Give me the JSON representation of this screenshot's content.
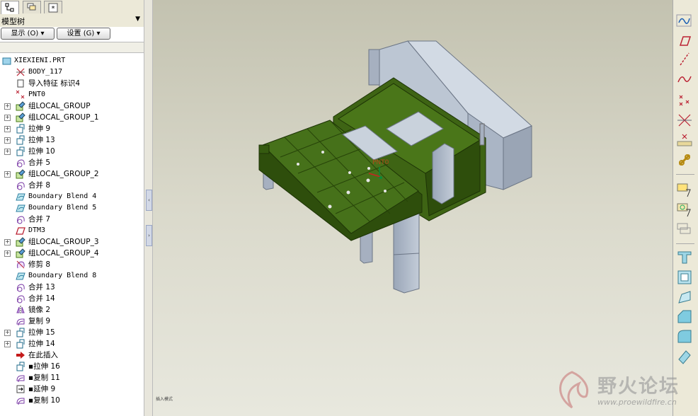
{
  "tree_panel": {
    "title": "模型树",
    "show_button": "显示 (O) ▾",
    "settings_button": "设置 (G) ▾",
    "items": [
      {
        "label": "XIEXIENI.PRT",
        "icon": "part-icon",
        "expand": false,
        "level": 0
      },
      {
        "label": "BODY_117",
        "icon": "body-icon",
        "expand": false,
        "level": 1
      },
      {
        "label": "导入特征 标识4",
        "icon": "import-feature-icon",
        "expand": false,
        "level": 1
      },
      {
        "label": "PNT0",
        "icon": "datum-point-icon",
        "expand": false,
        "level": 1
      },
      {
        "label": "组LOCAL_GROUP",
        "icon": "group-icon",
        "expand": true,
        "level": 1
      },
      {
        "label": "组LOCAL_GROUP_1",
        "icon": "group-icon",
        "expand": true,
        "level": 1
      },
      {
        "label": "拉伸 9",
        "icon": "extrude-icon",
        "expand": true,
        "level": 1
      },
      {
        "label": "拉伸 13",
        "icon": "extrude-icon",
        "expand": true,
        "level": 1
      },
      {
        "label": "拉伸 10",
        "icon": "extrude-icon",
        "expand": true,
        "level": 1
      },
      {
        "label": "合并 5",
        "icon": "merge-icon",
        "expand": false,
        "level": 1
      },
      {
        "label": "组LOCAL_GROUP_2",
        "icon": "group-icon",
        "expand": true,
        "level": 1
      },
      {
        "label": "合并 8",
        "icon": "merge-icon",
        "expand": false,
        "level": 1
      },
      {
        "label": "Boundary Blend 4",
        "icon": "boundary-blend-icon",
        "expand": false,
        "level": 1
      },
      {
        "label": "Boundary Blend 5",
        "icon": "boundary-blend-icon",
        "expand": false,
        "level": 1
      },
      {
        "label": "合并 7",
        "icon": "merge-icon",
        "expand": false,
        "level": 1
      },
      {
        "label": "DTM3",
        "icon": "datum-plane-icon",
        "expand": false,
        "level": 1
      },
      {
        "label": "组LOCAL_GROUP_3",
        "icon": "group-icon",
        "expand": true,
        "level": 1
      },
      {
        "label": "组LOCAL_GROUP_4",
        "icon": "group-icon",
        "expand": true,
        "level": 1
      },
      {
        "label": "修剪 8",
        "icon": "trim-icon",
        "expand": false,
        "level": 1
      },
      {
        "label": "Boundary Blend 8",
        "icon": "boundary-blend-icon",
        "expand": false,
        "level": 1
      },
      {
        "label": "合并 13",
        "icon": "merge-icon",
        "expand": false,
        "level": 1
      },
      {
        "label": "合并 14",
        "icon": "merge-icon",
        "expand": false,
        "level": 1
      },
      {
        "label": "镜像 2",
        "icon": "mirror-icon",
        "expand": false,
        "level": 1
      },
      {
        "label": "复制 9",
        "icon": "copy-icon",
        "expand": false,
        "level": 1
      },
      {
        "label": "拉伸 15",
        "icon": "extrude-icon",
        "expand": true,
        "level": 1
      },
      {
        "label": "拉伸 14",
        "icon": "extrude-icon",
        "expand": true,
        "level": 1
      },
      {
        "label": "在此插入",
        "icon": "insert-here-arrow-icon",
        "expand": false,
        "level": 1
      },
      {
        "label": "▪拉伸 16",
        "icon": "extrude-icon",
        "expand": false,
        "level": 1
      },
      {
        "label": "▪复制 11",
        "icon": "copy-icon",
        "expand": false,
        "level": 1
      },
      {
        "label": "▪延伸 9",
        "icon": "extend-icon",
        "expand": false,
        "level": 1
      },
      {
        "label": "▪复制 10",
        "icon": "copy-icon",
        "expand": false,
        "level": 1
      }
    ]
  },
  "viewport": {
    "point_label": "PNT0",
    "status_text": "插入模式"
  },
  "right_toolbar": [
    "datum-curve-icon",
    "datum-plane-tool-icon",
    "datum-axis-icon",
    "sketched-curve-icon",
    "datum-point-icon",
    "offset-point-icon",
    "field-point-icon",
    "coordinate-system-icon",
    "sketch-tool-icon",
    "analysis-feature-icon",
    "reference-feature-icon",
    "extrude-tool-icon",
    "shell-tool-icon",
    "draft-tool-icon",
    "chamfer-tool-icon",
    "round-tool-icon",
    "rib-tool-icon"
  ],
  "watermark": {
    "cn": "野火论坛",
    "url": "www.proewildfire.cn"
  },
  "colors": {
    "model_green": "#3e6414",
    "model_grey": "#a9b5c6",
    "viewport_top": "#c3c2b0",
    "viewport_bottom": "#e8e8de"
  }
}
